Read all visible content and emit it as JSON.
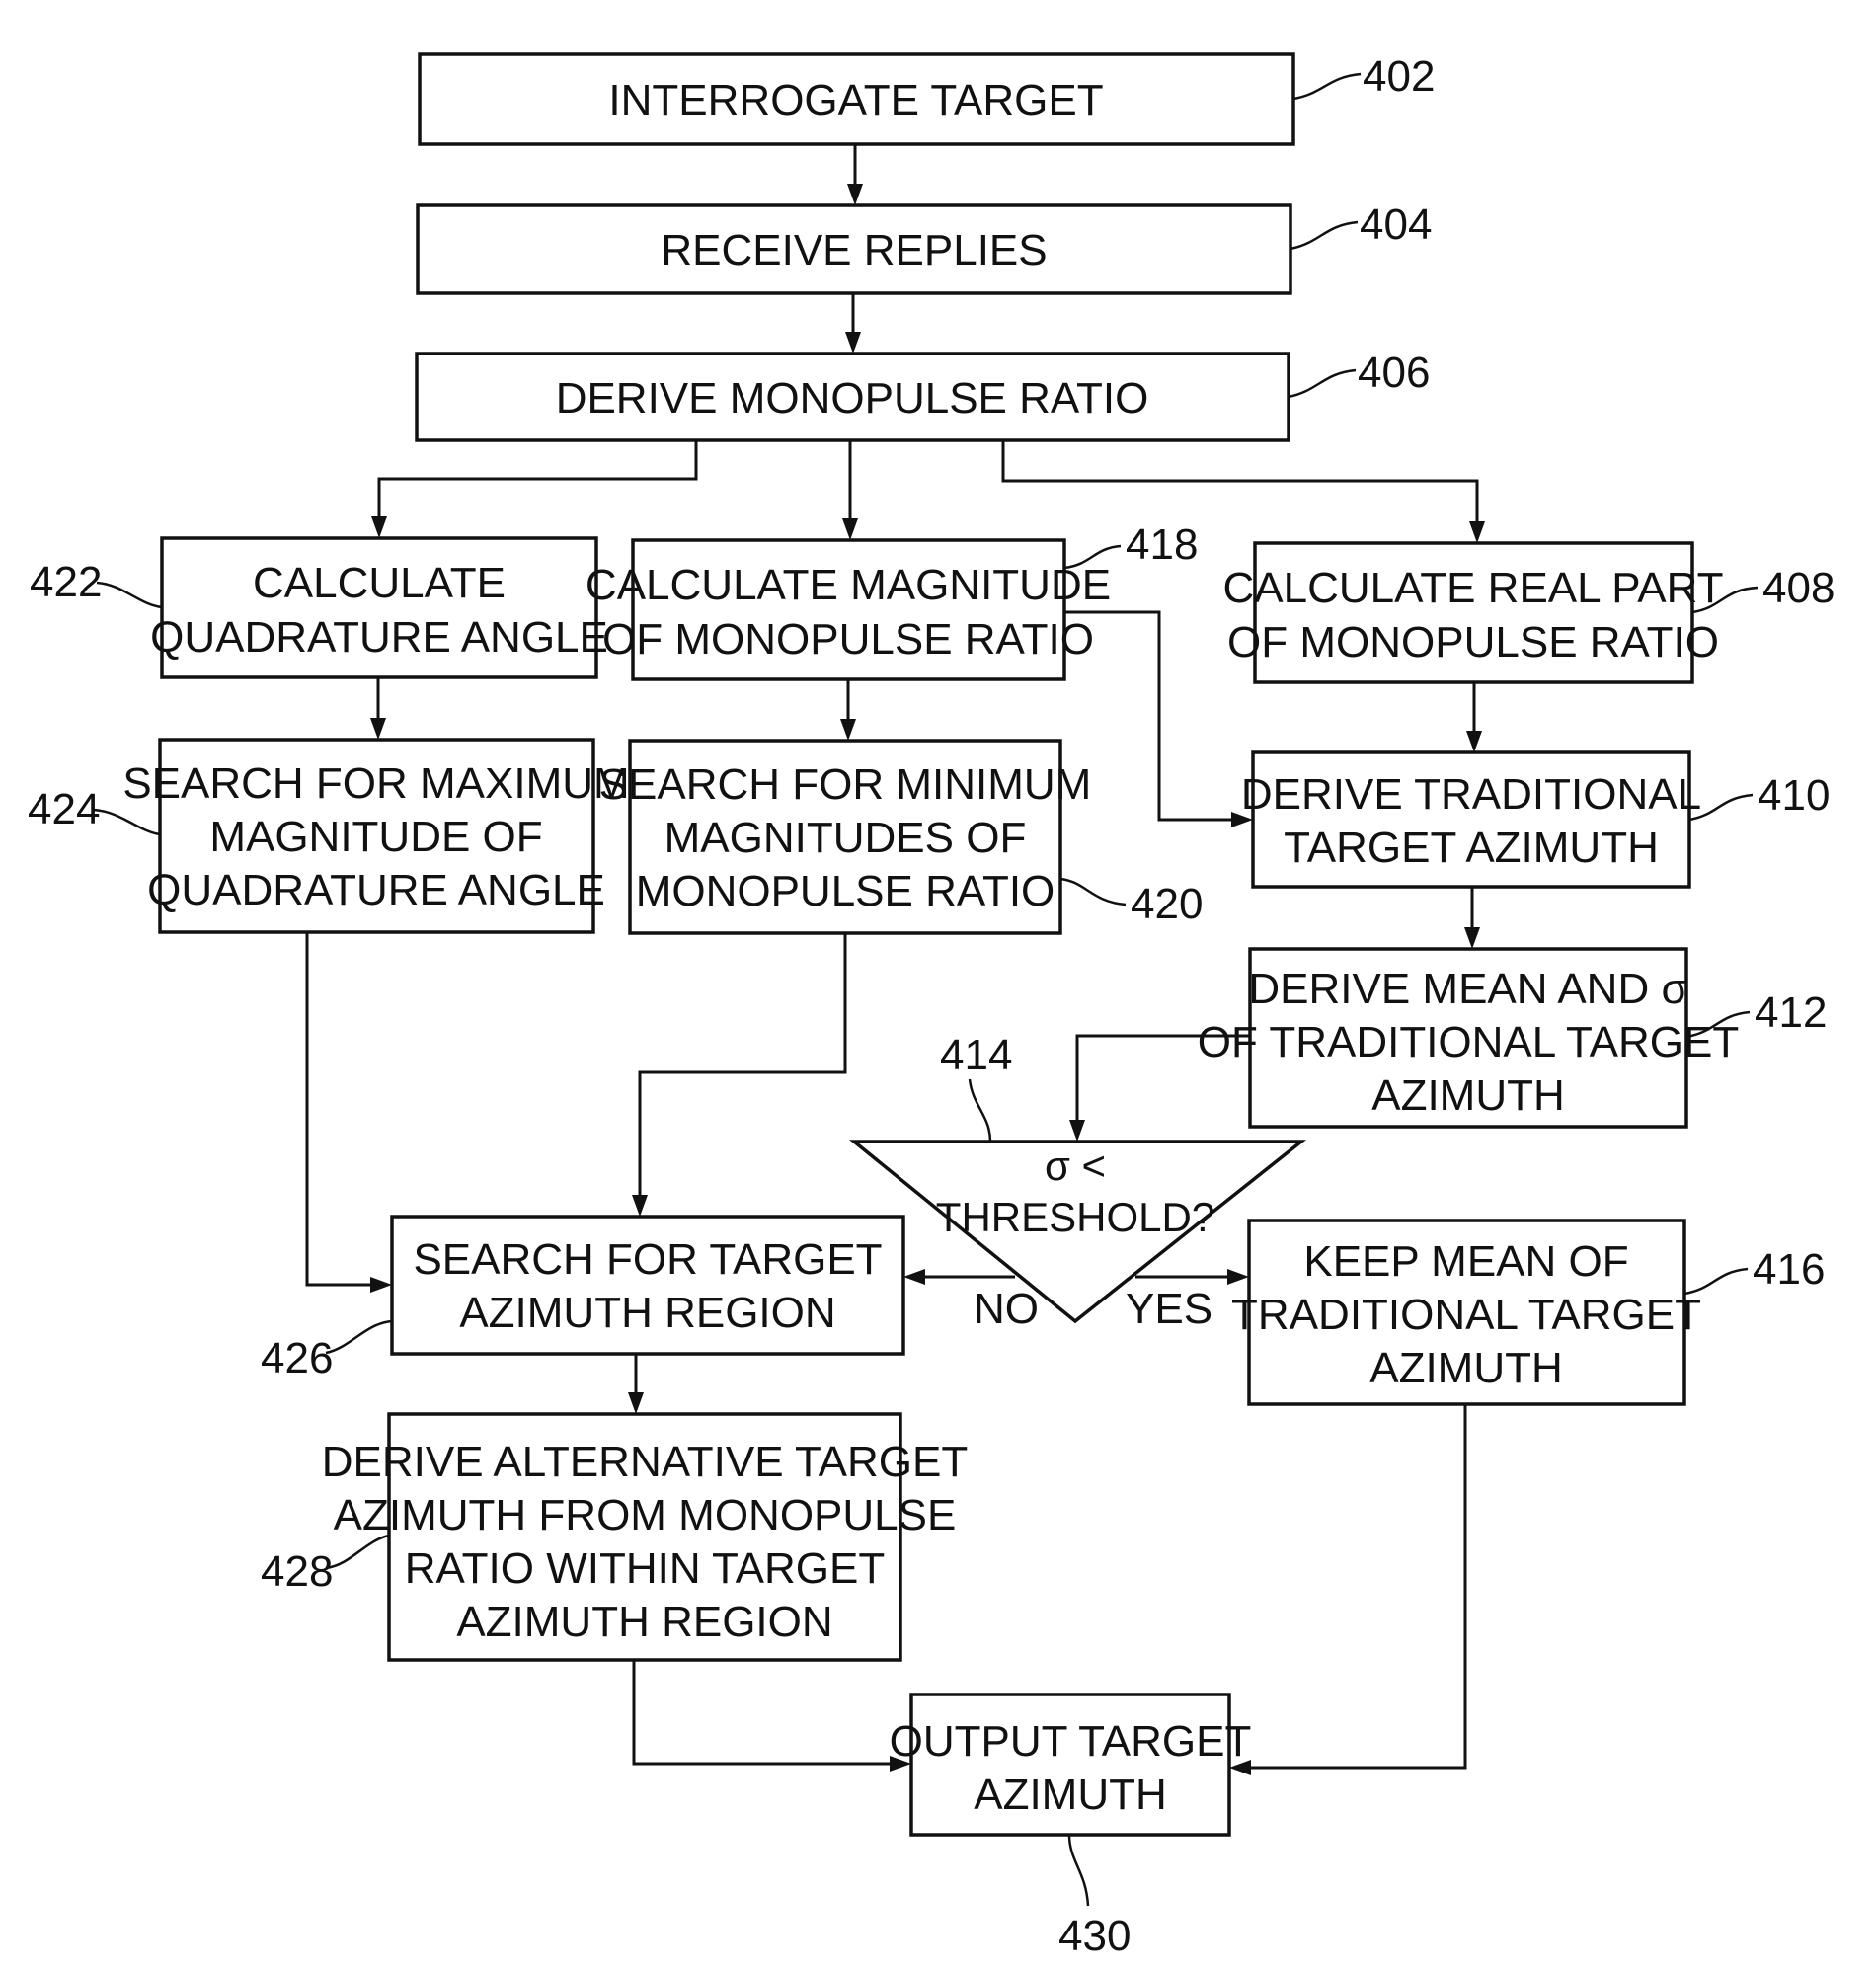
{
  "figure": {
    "steps": {
      "s402": {
        "ref": "402",
        "lines": [
          "INTERROGATE TARGET"
        ]
      },
      "s404": {
        "ref": "404",
        "lines": [
          "RECEIVE REPLIES"
        ]
      },
      "s406": {
        "ref": "406",
        "lines": [
          "DERIVE MONOPULSE RATIO"
        ]
      },
      "s422": {
        "ref": "422",
        "lines": [
          "CALCULATE",
          "QUADRATURE ANGLE"
        ]
      },
      "s418": {
        "ref": "418",
        "lines": [
          "CALCULATE MAGNITUDE",
          "OF MONOPULSE RATIO"
        ]
      },
      "s408": {
        "ref": "408",
        "lines": [
          "CALCULATE REAL PART",
          "OF MONOPULSE RATIO"
        ]
      },
      "s424": {
        "ref": "424",
        "lines": [
          "SEARCH FOR MAXIMUM",
          "MAGNITUDE OF",
          "QUADRATURE ANGLE"
        ]
      },
      "s420": {
        "ref": "420",
        "lines": [
          "SEARCH FOR MINIMUM",
          "MAGNITUDES OF",
          "MONOPULSE RATIO"
        ]
      },
      "s410": {
        "ref": "410",
        "lines": [
          "DERIVE TRADITIONAL",
          "TARGET AZIMUTH"
        ]
      },
      "s412": {
        "ref": "412",
        "lines": [
          "DERIVE MEAN AND σ",
          "OF TRADITIONAL TARGET",
          "AZIMUTH"
        ]
      },
      "s414": {
        "ref": "414",
        "lines": [
          "σ <",
          "THRESHOLD?"
        ],
        "no_label": "NO",
        "yes_label": "YES"
      },
      "s426": {
        "ref": "426",
        "lines": [
          "SEARCH FOR TARGET",
          "AZIMUTH REGION"
        ]
      },
      "s416": {
        "ref": "416",
        "lines": [
          "KEEP MEAN OF",
          "TRADITIONAL TARGET",
          "AZIMUTH"
        ]
      },
      "s428": {
        "ref": "428",
        "lines": [
          "DERIVE ALTERNATIVE TARGET",
          "AZIMUTH FROM MONOPULSE",
          "RATIO WITHIN TARGET",
          "AZIMUTH REGION"
        ]
      },
      "s430": {
        "ref": "430",
        "lines": [
          "OUTPUT TARGET",
          "AZIMUTH"
        ]
      }
    }
  }
}
